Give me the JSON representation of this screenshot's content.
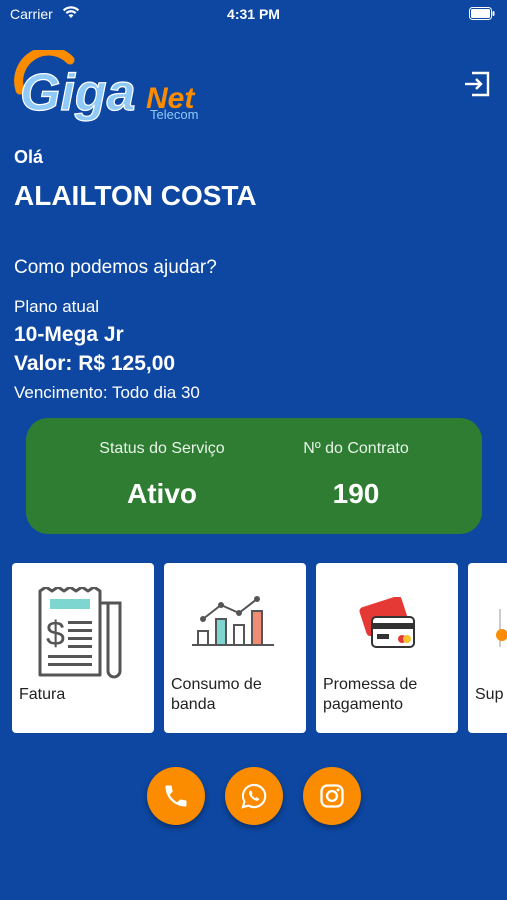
{
  "status_bar": {
    "carrier": "Carrier",
    "time": "4:31 PM"
  },
  "logo": {
    "brand_giga": "Giga",
    "brand_net": "Net",
    "brand_sub": "Telecom"
  },
  "header": {
    "greeting": "Olá",
    "user_name": "ALAILTON COSTA",
    "help_text": "Como podemos ajudar?"
  },
  "plan": {
    "label": "Plano atual",
    "name": "10-Mega Jr",
    "value": "Valor: R$ 125,00",
    "due": "Vencimento: Todo dia 30"
  },
  "status_card": {
    "service_label": "Status do Serviço",
    "service_value": "Ativo",
    "contract_label": "Nº do Contrato",
    "contract_value": "190",
    "color": "#2e7d32"
  },
  "cards": [
    {
      "label": "Fatura",
      "icon": "invoice-icon"
    },
    {
      "label": "Consumo de banda",
      "icon": "bandwidth-chart-icon"
    },
    {
      "label": "Promessa de pagamento",
      "icon": "credit-card-icon"
    },
    {
      "label": "Sup",
      "icon": "support-icon"
    }
  ],
  "social": [
    {
      "icon": "phone-icon"
    },
    {
      "icon": "whatsapp-icon"
    },
    {
      "icon": "instagram-icon"
    }
  ],
  "colors": {
    "background": "#0d47a1",
    "accent": "#fb8c00",
    "status_green": "#2e7d32"
  }
}
